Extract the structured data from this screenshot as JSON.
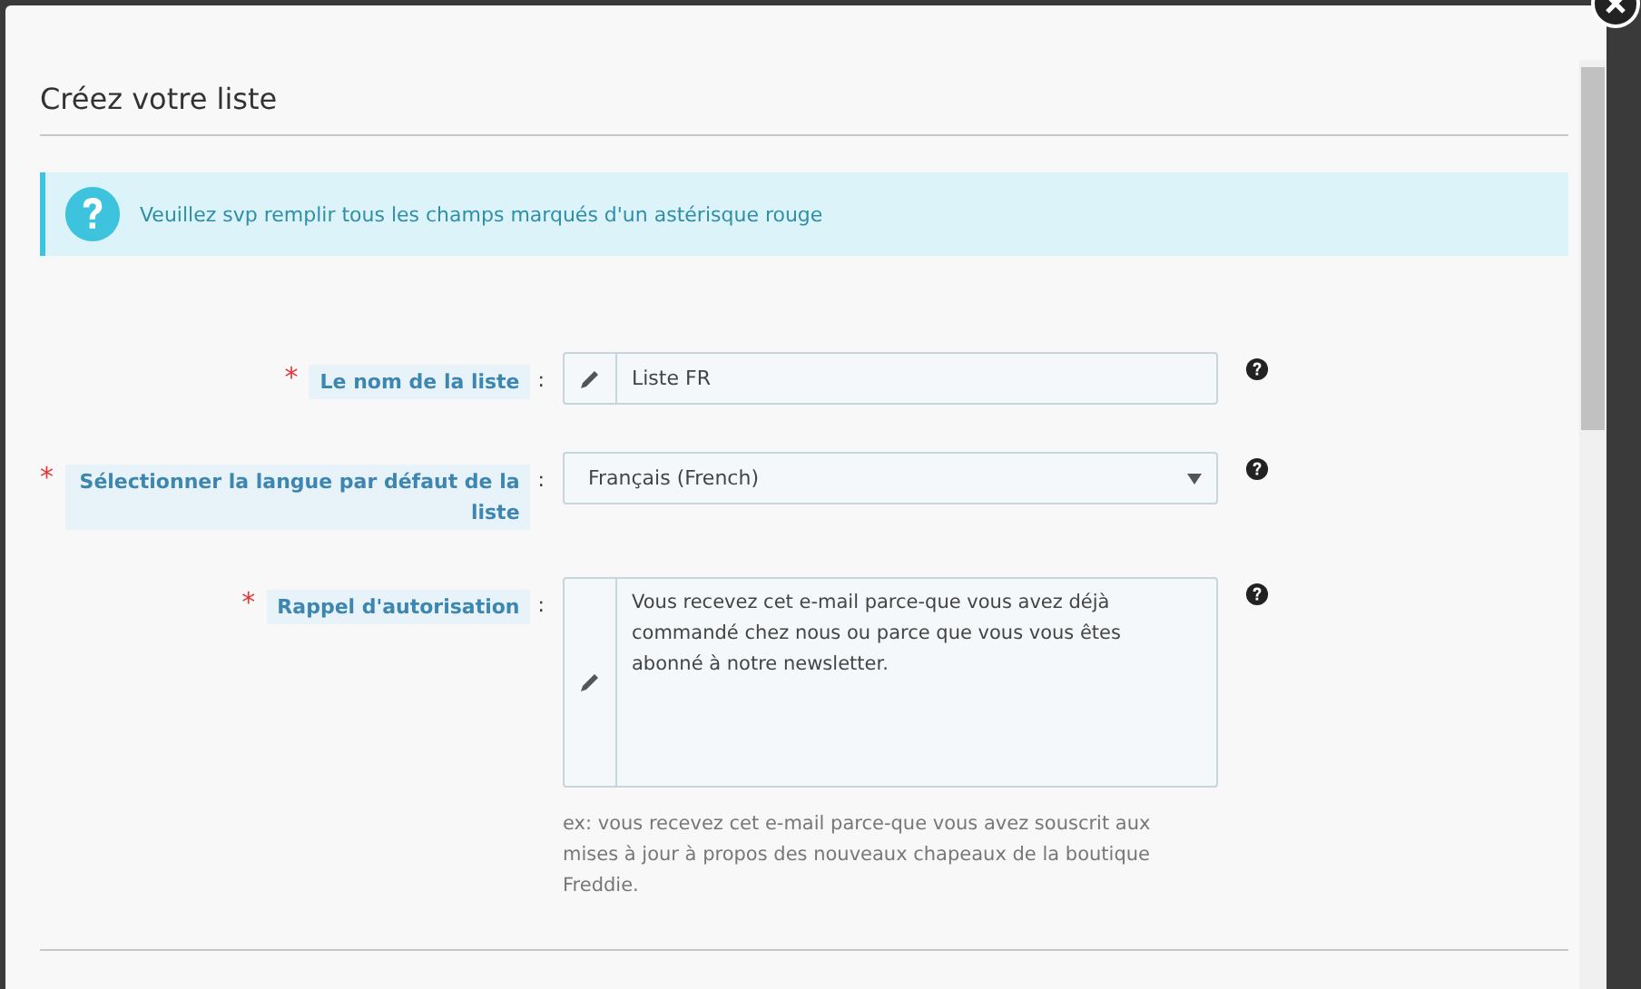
{
  "dialog": {
    "title": "Créez votre liste"
  },
  "alert": {
    "message": "Veuillez svp remplir tous les champs marqués d'un astérisque rouge"
  },
  "fields": [
    {
      "kind": "text",
      "marker": "*",
      "label": "Le nom de la liste",
      "colon": ":",
      "required": true,
      "value": "Liste FR",
      "help": true
    },
    {
      "kind": "select",
      "marker": "*",
      "label": "Sélectionner la langue par défaut de la liste",
      "colon": ":",
      "required": true,
      "value": "Français (French)",
      "help": true
    },
    {
      "kind": "textarea",
      "marker": "*",
      "label": "Rappel d'autorisation",
      "colon": ":",
      "required": true,
      "value": "Vous recevez cet e-mail parce-que vous avez déjà commandé chez nous ou parce que vous vous êtes abonné à notre newsletter.",
      "help": true,
      "hint": "ex: vous recevez cet e-mail parce-que vous avez souscrit aux mises à jour à propos des nouveaux chapeaux de la boutique Freddie."
    }
  ]
}
